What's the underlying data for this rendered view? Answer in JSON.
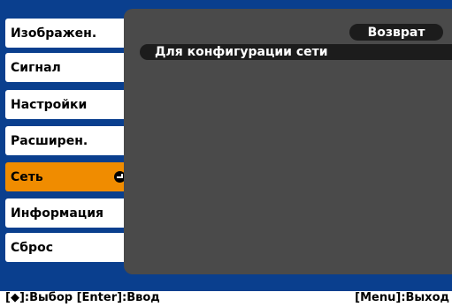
{
  "menu": {
    "items": [
      {
        "label": "Изображен."
      },
      {
        "label": "Сигнал"
      },
      {
        "label": "Настройки"
      },
      {
        "label": "Расширен."
      },
      {
        "label": "Сеть"
      },
      {
        "label": "Информация"
      },
      {
        "label": "Сброс"
      }
    ],
    "active_index": 4
  },
  "panel": {
    "back_label": "Возврат",
    "config_label": "Для конфигурации сети"
  },
  "footer": {
    "left_hint": "[◆]:Выбор [Enter]:Ввод",
    "right_hint": "[Menu]:Выход"
  },
  "colors": {
    "background": "#0a3f8e",
    "panel": "#4a4a4a",
    "active": "#f08c00"
  },
  "icons": {
    "selected_item": "enter-icon"
  }
}
